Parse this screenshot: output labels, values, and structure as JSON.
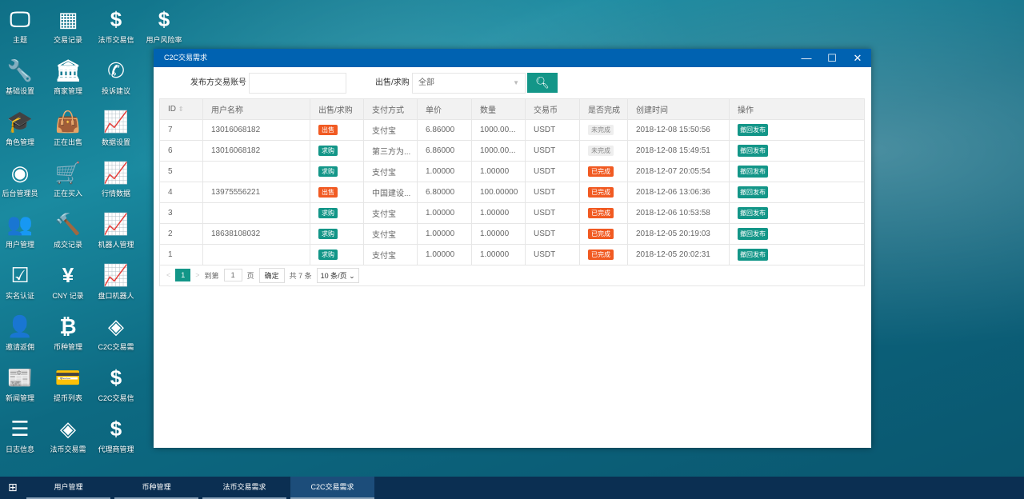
{
  "desktop": [
    {
      "label": "主题",
      "icon": "monitor-icon",
      "glyph": "🖵"
    },
    {
      "label": "交易记录",
      "icon": "building-icon",
      "glyph": "▦"
    },
    {
      "label": "法币交易信",
      "icon": "dollar-icon",
      "glyph": "$"
    },
    {
      "label": "用户风险率",
      "icon": "dollar-icon",
      "glyph": "$"
    },
    {
      "label": "基础设置",
      "icon": "wrench-icon",
      "glyph": "🔧"
    },
    {
      "label": "商家管理",
      "icon": "bank-icon",
      "glyph": "🏛"
    },
    {
      "label": "投诉建议",
      "icon": "phone-icon",
      "glyph": "✆"
    },
    {
      "label": "角色管理",
      "icon": "graduation-cap-icon",
      "glyph": "🎓"
    },
    {
      "label": "正在出售",
      "icon": "shopping-bag-icon",
      "glyph": "👜"
    },
    {
      "label": "数据设置",
      "icon": "line-chart-icon",
      "glyph": "📈"
    },
    {
      "label": "后台管理员",
      "icon": "user-circle-icon",
      "glyph": "◉"
    },
    {
      "label": "正在买入",
      "icon": "cart-icon",
      "glyph": "🛒"
    },
    {
      "label": "行情数据",
      "icon": "line-chart-icon",
      "glyph": "📈"
    },
    {
      "label": "用户管理",
      "icon": "users-icon",
      "glyph": "👥"
    },
    {
      "label": "成交记录",
      "icon": "gavel-icon",
      "glyph": "🔨"
    },
    {
      "label": "机器人管理",
      "icon": "line-chart-icon",
      "glyph": "📈"
    },
    {
      "label": "实名认证",
      "icon": "check-square-icon",
      "glyph": "☑"
    },
    {
      "label": "CNY 记录",
      "icon": "yen-icon",
      "glyph": "¥"
    },
    {
      "label": "盘口机器人",
      "icon": "line-chart-icon",
      "glyph": "📈"
    },
    {
      "label": "邀请返佣",
      "icon": "user-plus-icon",
      "glyph": "👤"
    },
    {
      "label": "币种管理",
      "icon": "bitcoin-icon",
      "glyph": "₿"
    },
    {
      "label": "C2C交易需",
      "icon": "exchange-icon",
      "glyph": "◈"
    },
    {
      "label": "新闻管理",
      "icon": "newspaper-icon",
      "glyph": "📰"
    },
    {
      "label": "提币列表",
      "icon": "credit-card-icon",
      "glyph": "💳"
    },
    {
      "label": "C2C交易信",
      "icon": "dollar-icon",
      "glyph": "$"
    },
    {
      "label": "日志信息",
      "icon": "list-icon",
      "glyph": "☰"
    },
    {
      "label": "法币交易需",
      "icon": "exchange-icon",
      "glyph": "◈"
    },
    {
      "label": "代理商管理",
      "icon": "dollar-icon",
      "glyph": "$"
    }
  ],
  "window": {
    "title": "C2C交易需求",
    "minimize": "—",
    "maximize": "☐",
    "close": "✕"
  },
  "search": {
    "account_label": "发布方交易账号",
    "account_value": "",
    "type_label": "出售/求购",
    "type_value": "全部",
    "search_icon": "search-icon"
  },
  "table": {
    "headers": [
      "ID",
      "用户名称",
      "出售/求购",
      "支付方式",
      "单价",
      "数量",
      "交易币",
      "是否完成",
      "创建时间",
      "操作"
    ],
    "rows": [
      {
        "id": "7",
        "user": "13016068182",
        "type": "出售",
        "type_kind": "sell",
        "pay": "支付宝",
        "price": "6.86000",
        "qty": "1000.00...",
        "coin": "USDT",
        "status": "未完成",
        "status_kind": "undone",
        "time": "2018-12-08 15:50:56",
        "action": "撤回发布"
      },
      {
        "id": "6",
        "user": "13016068182",
        "type": "求购",
        "type_kind": "buy",
        "pay": "第三方为...",
        "price": "6.86000",
        "qty": "1000.00...",
        "coin": "USDT",
        "status": "未完成",
        "status_kind": "undone",
        "time": "2018-12-08 15:49:51",
        "action": "撤回发布"
      },
      {
        "id": "5",
        "user": "",
        "type": "求购",
        "type_kind": "buy",
        "pay": "支付宝",
        "price": "1.00000",
        "qty": "1.00000",
        "coin": "USDT",
        "status": "已完成",
        "status_kind": "done",
        "time": "2018-12-07 20:05:54",
        "action": "撤回发布"
      },
      {
        "id": "4",
        "user": "13975556221",
        "type": "出售",
        "type_kind": "sell",
        "pay": "中国建设...",
        "price": "6.80000",
        "qty": "100.00000",
        "coin": "USDT",
        "status": "已完成",
        "status_kind": "done",
        "time": "2018-12-06 13:06:36",
        "action": "撤回发布"
      },
      {
        "id": "3",
        "user": "",
        "type": "求购",
        "type_kind": "buy",
        "pay": "支付宝",
        "price": "1.00000",
        "qty": "1.00000",
        "coin": "USDT",
        "status": "已完成",
        "status_kind": "done",
        "time": "2018-12-06 10:53:58",
        "action": "撤回发布"
      },
      {
        "id": "2",
        "user": "18638108032",
        "type": "求购",
        "type_kind": "buy",
        "pay": "支付宝",
        "price": "1.00000",
        "qty": "1.00000",
        "coin": "USDT",
        "status": "已完成",
        "status_kind": "done",
        "time": "2018-12-05 20:19:03",
        "action": "撤回发布"
      },
      {
        "id": "1",
        "user": "",
        "type": "求购",
        "type_kind": "buy",
        "pay": "支付宝",
        "price": "1.00000",
        "qty": "1.00000",
        "coin": "USDT",
        "status": "已完成",
        "status_kind": "done",
        "time": "2018-12-05 20:02:31",
        "action": "撤回发布"
      }
    ]
  },
  "pager": {
    "prev": "<",
    "current": "1",
    "next": ">",
    "goto_label": "到第",
    "goto_value": "1",
    "page_label": "页",
    "confirm": "确定",
    "total": "共 7 条",
    "page_size": "10 条/页"
  },
  "taskbar": {
    "start_icon": "windows-icon",
    "tabs": [
      "用户管理",
      "币种管理",
      "法币交易需求",
      "C2C交易需求"
    ],
    "active": 3
  },
  "colors": {
    "accent": "#139688",
    "titlebar": "#0062b1",
    "danger": "#f15a22"
  }
}
